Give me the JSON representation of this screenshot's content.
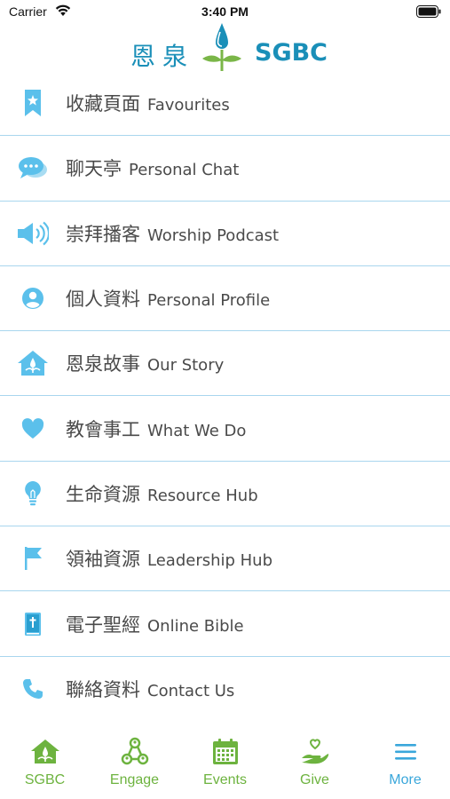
{
  "status_bar": {
    "carrier": "Carrier",
    "time": "3:40 PM"
  },
  "header": {
    "logo_cn": "恩泉",
    "logo_en": "SGBC"
  },
  "colors": {
    "accent_blue": "#5bc0eb",
    "brand_blue": "#1a8fb8",
    "brand_green": "#7ab648",
    "tab_green": "#6db33f",
    "divider": "#a9d6ee"
  },
  "menu": {
    "items": [
      {
        "cn": "收藏頁面",
        "en": "Favourites",
        "icon": "bookmark-star-icon"
      },
      {
        "cn": "聊天亭",
        "en": "Personal Chat",
        "icon": "chat-bubbles-icon"
      },
      {
        "cn": "崇拜播客",
        "en": "Worship Podcast",
        "icon": "speaker-icon"
      },
      {
        "cn": "個人資料",
        "en": "Personal Profile",
        "icon": "user-circle-icon"
      },
      {
        "cn": "恩泉故事",
        "en": "Our Story",
        "icon": "church-house-icon"
      },
      {
        "cn": "教會事工",
        "en": "What We Do",
        "icon": "heart-icon"
      },
      {
        "cn": "生命資源",
        "en": "Resource Hub",
        "icon": "lightbulb-icon"
      },
      {
        "cn": "領袖資源",
        "en": "Leadership Hub",
        "icon": "flag-icon"
      },
      {
        "cn": "電子聖經",
        "en": "Online Bible",
        "icon": "bible-icon"
      },
      {
        "cn": "聯絡資料",
        "en": "Contact Us",
        "icon": "phone-icon"
      }
    ]
  },
  "tabs": [
    {
      "label": "SGBC",
      "icon": "home-church-icon",
      "active": false
    },
    {
      "label": "Engage",
      "icon": "people-network-icon",
      "active": false
    },
    {
      "label": "Events",
      "icon": "calendar-icon",
      "active": false
    },
    {
      "label": "Give",
      "icon": "giving-hand-icon",
      "active": false
    },
    {
      "label": "More",
      "icon": "hamburger-menu-icon",
      "active": true
    }
  ]
}
